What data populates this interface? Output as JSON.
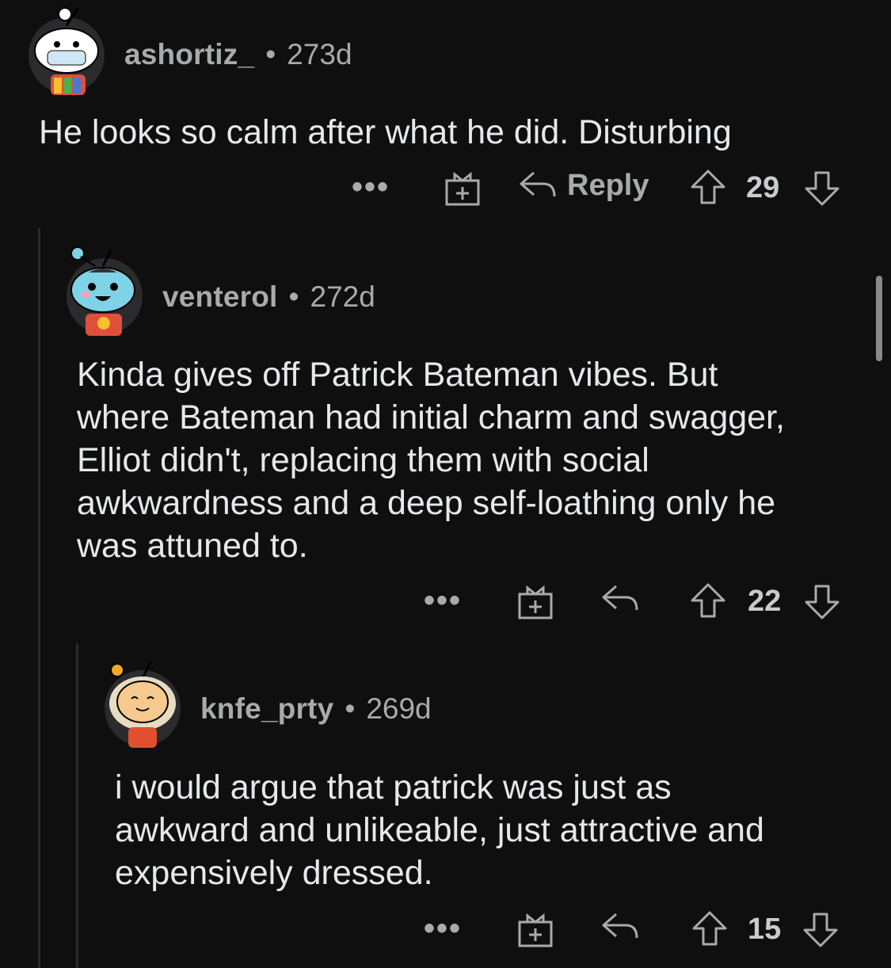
{
  "comments": [
    {
      "username": "ashortiz_",
      "separator": "•",
      "age": "273d",
      "body": "He looks so calm after what he did. Disturbing",
      "more_label": "•••",
      "reply_label": "Reply",
      "score": "29"
    },
    {
      "username": "venterol",
      "separator": "•",
      "age": "272d",
      "body": "Kinda gives off Patrick Bateman vibes. But\nwhere Bateman had initial charm and swagger,\nElliot didn't, replacing them with social\nawkwardness and a deep self-loathing only he\nwas attuned to.",
      "more_label": "•••",
      "score": "22"
    },
    {
      "username": "knfe_prty",
      "separator": "•",
      "age": "269d",
      "body": "i would argue that patrick was just as\nawkward and unlikeable, just attractive and\nexpensively dressed.",
      "more_label": "•••",
      "score": "15"
    }
  ],
  "icons": {
    "more": "more-dots-icon",
    "award": "gift-award-icon",
    "reply": "reply-arrow-icon",
    "upvote": "upvote-arrow-icon",
    "downvote": "downvote-arrow-icon"
  },
  "colors": {
    "background": "#0f0f0f",
    "text": "#e6e8ea",
    "muted": "#a8aaab",
    "thread_line": "#2a2a2b"
  }
}
